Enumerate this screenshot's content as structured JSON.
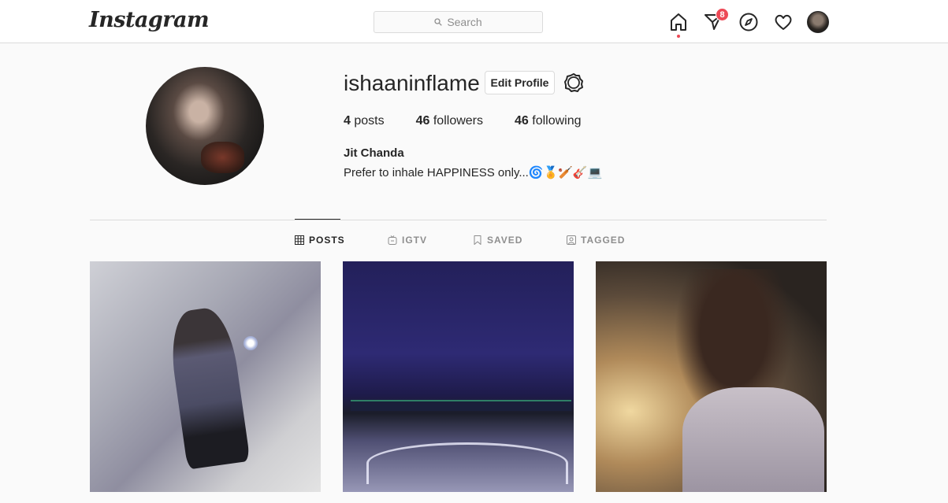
{
  "header": {
    "logo": "Instagram",
    "search_placeholder": "Search",
    "notification_count": "8"
  },
  "profile": {
    "username": "ishaaninflame",
    "edit_label": "Edit Profile",
    "posts_count": "4",
    "posts_label": "posts",
    "followers_count": "46",
    "followers_label": "followers",
    "following_count": "46",
    "following_label": "following",
    "full_name": "Jit Chanda",
    "bio": "Prefer to inhale HAPPINESS only...🌀🏅🏏🎸💻"
  },
  "tabs": [
    {
      "label": "POSTS",
      "icon": "grid-icon",
      "active": true
    },
    {
      "label": "IGTV",
      "icon": "igtv-icon",
      "active": false
    },
    {
      "label": "SAVED",
      "icon": "bookmark-icon",
      "active": false
    },
    {
      "label": "TAGGED",
      "icon": "tag-icon",
      "active": false
    }
  ],
  "colors": {
    "accent_red": "#ed4956",
    "border": "#dbdbdb",
    "text": "#262626",
    "muted": "#8e8e8e"
  }
}
